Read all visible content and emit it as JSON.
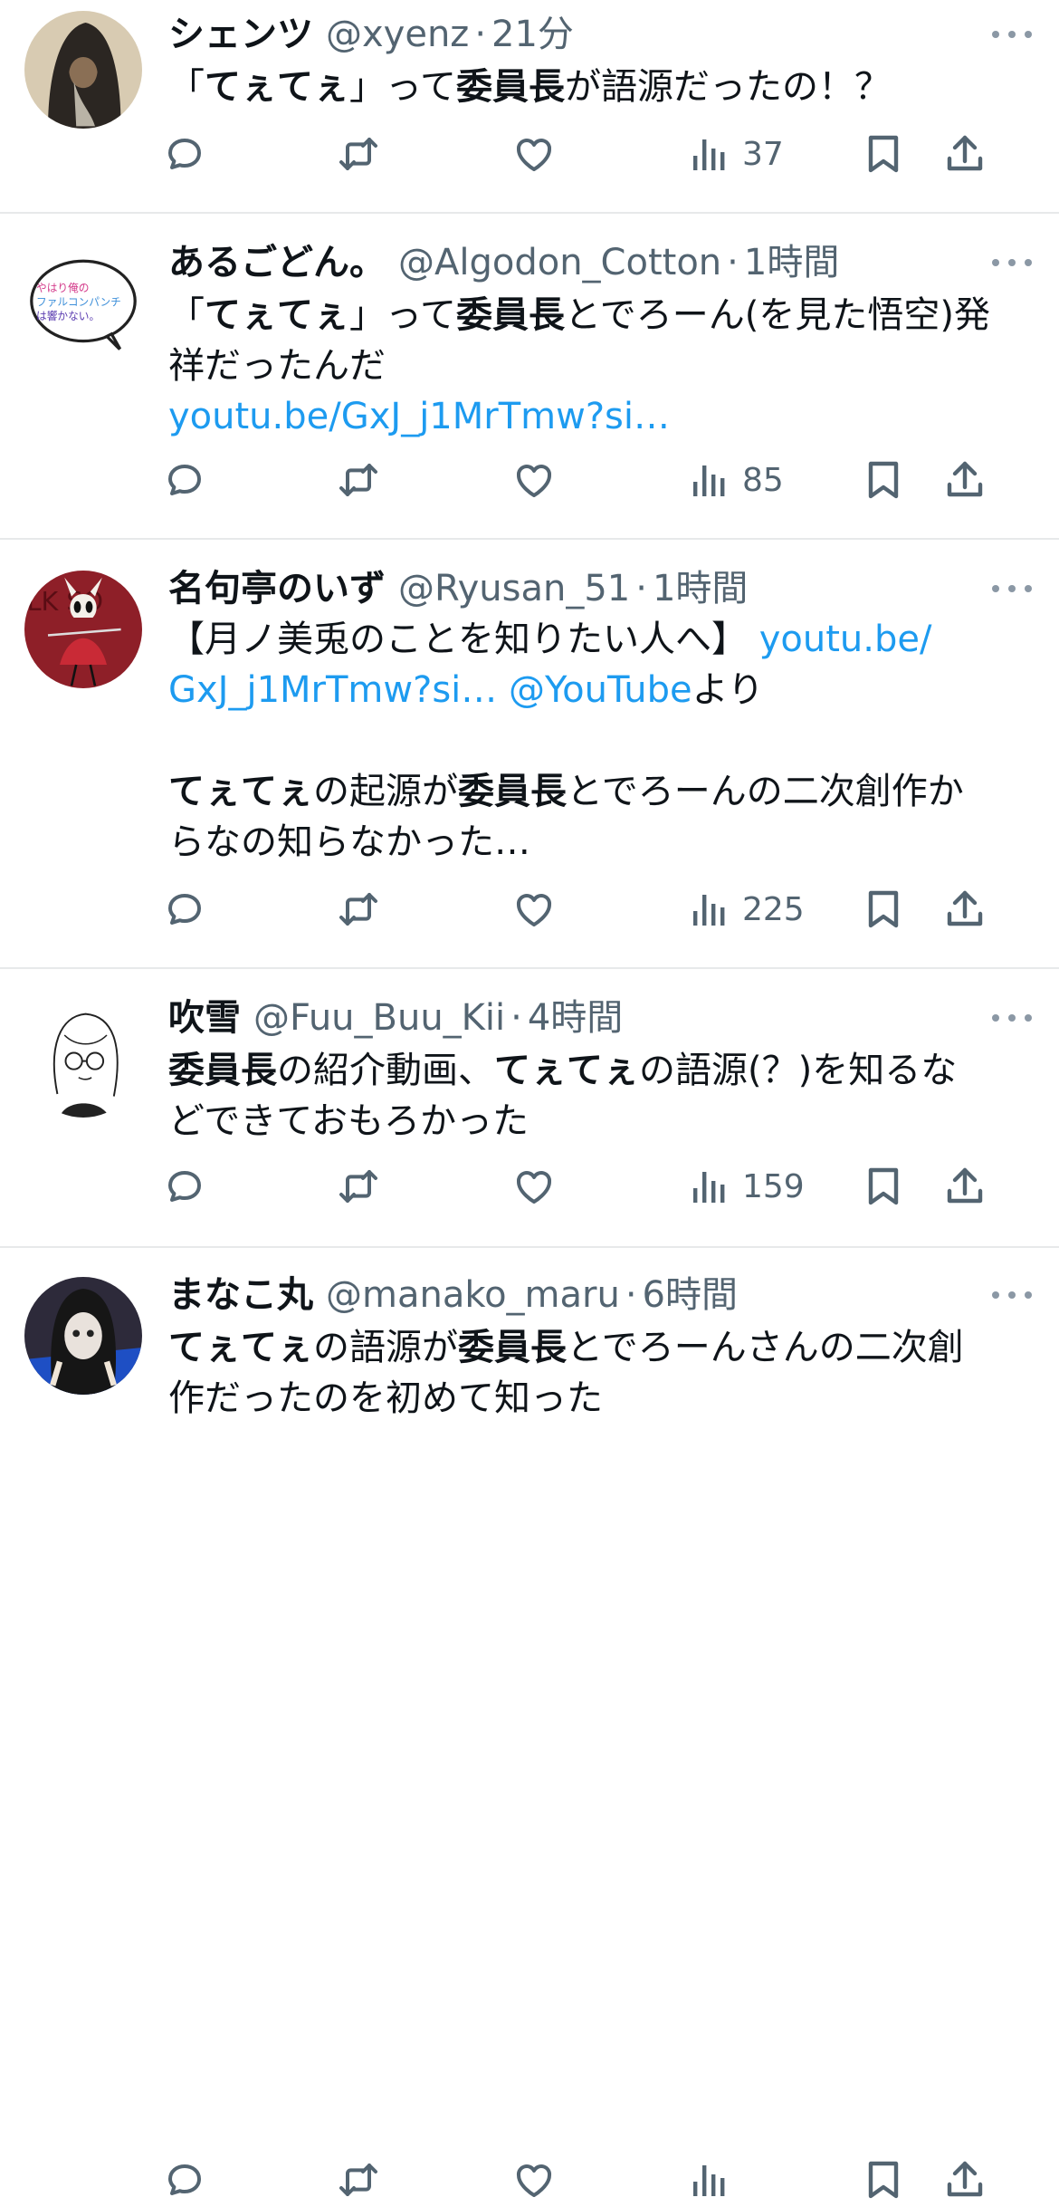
{
  "tweets": [
    {
      "name": "シェンツ",
      "handle": "@xyenz",
      "time": "21分",
      "lines": [
        [
          {
            "t": "「"
          },
          {
            "t": "てぇてぇ",
            "b": true
          },
          {
            "t": "」って"
          },
          {
            "t": "委員長",
            "b": true
          },
          {
            "t": "が語源だったの！？"
          }
        ]
      ],
      "views": "37"
    },
    {
      "name": "あるごどん。",
      "handle": "@Algodon_Cotton",
      "time": "1時間",
      "lines": [
        [
          {
            "t": "「"
          },
          {
            "t": "てぇてぇ",
            "b": true
          },
          {
            "t": "」って"
          },
          {
            "t": "委員長",
            "b": true
          },
          {
            "t": "とでろーん(を見た悟空)発"
          }
        ],
        [
          {
            "t": "祥だったんだ"
          }
        ],
        [
          {
            "t": "youtu.be/GxJ_j1MrTmw?si…",
            "link": true
          }
        ]
      ],
      "views": "85"
    },
    {
      "name": "名句亭のいず",
      "handle": "@Ryusan_51",
      "time": "1時間",
      "lines": [
        [
          {
            "t": "【月ノ美兎のことを知りたい人へ】 "
          },
          {
            "t": "youtu.be/",
            "link": true
          }
        ],
        [
          {
            "t": "GxJ_j1MrTmw?si…",
            "link": true
          },
          {
            "t": " "
          },
          {
            "t": "@YouTube",
            "link": true
          },
          {
            "t": "より"
          }
        ],
        [
          {
            "t": ""
          }
        ],
        [
          {
            "t": "てぇてぇ",
            "b": true
          },
          {
            "t": "の起源が"
          },
          {
            "t": "委員長",
            "b": true
          },
          {
            "t": "とでろーんの二次創作か"
          }
        ],
        [
          {
            "t": "らなの知らなかった…"
          }
        ]
      ],
      "views": "225"
    },
    {
      "name": "吹雪",
      "handle": "@Fuu_Buu_Kii",
      "time": "4時間",
      "lines": [
        [
          {
            "t": "委員長",
            "b": true
          },
          {
            "t": "の紹介動画、"
          },
          {
            "t": "てぇてぇ",
            "b": true
          },
          {
            "t": "の語源(？)を知るな"
          }
        ],
        [
          {
            "t": "どできておもろかった"
          }
        ]
      ],
      "views": "159"
    },
    {
      "name": "まなこ丸",
      "handle": "@manako_maru",
      "time": "6時間",
      "lines": [
        [
          {
            "t": "てぇてぇ",
            "b": true
          },
          {
            "t": "の語源が"
          },
          {
            "t": "委員長",
            "b": true
          },
          {
            "t": "とでろーんさんの二次創"
          }
        ],
        [
          {
            "t": "作だったのを初めて知った"
          }
        ]
      ],
      "views": ""
    }
  ],
  "avatar_text": {
    "algodon": [
      "やはり俺の",
      "ファルコンパンチ",
      "は響かない。"
    ],
    "ryusan": "LK  SO"
  },
  "icons": {
    "reply": "reply-icon",
    "retweet": "retweet-icon",
    "like": "like-icon",
    "views": "views-icon",
    "bookmark": "bookmark-icon",
    "share": "share-icon",
    "more": "more-icon"
  },
  "colors": {
    "text": "#0f1419",
    "secondary": "#536471",
    "link": "#1d9bf0",
    "divider": "#e7e9ea"
  }
}
